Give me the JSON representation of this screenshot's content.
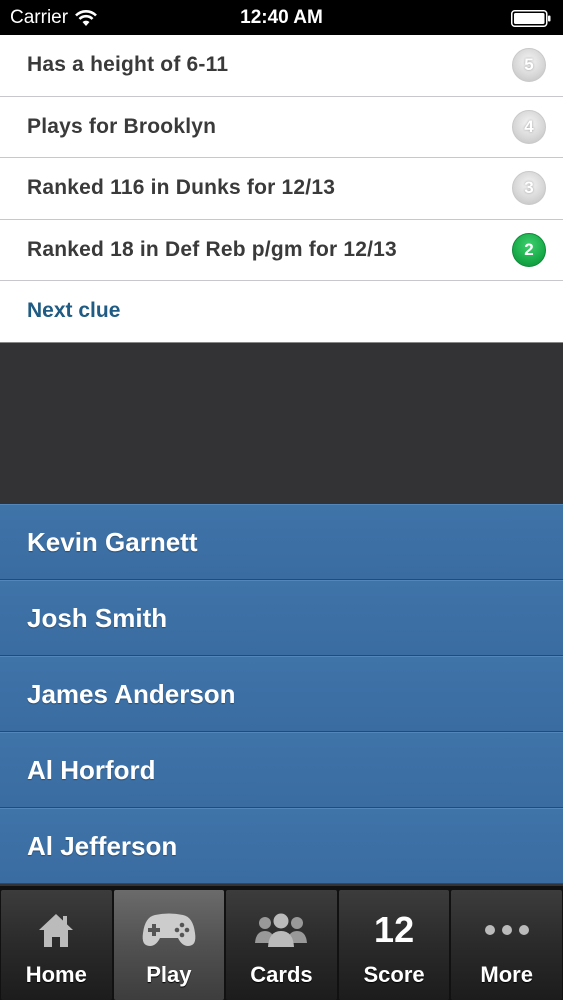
{
  "status": {
    "carrier": "Carrier",
    "time": "12:40 AM"
  },
  "clues": [
    {
      "text": "Has a height of 6-11",
      "badge": "5",
      "badge_style": "grey"
    },
    {
      "text": "Plays for Brooklyn",
      "badge": "4",
      "badge_style": "grey"
    },
    {
      "text": "Ranked 116 in Dunks for 12/13",
      "badge": "3",
      "badge_style": "grey"
    },
    {
      "text": "Ranked 18 in Def Reb p/gm for 12/13",
      "badge": "2",
      "badge_style": "green"
    }
  ],
  "next_clue_label": "Next clue",
  "answers": [
    "Kevin Garnett",
    "Josh Smith",
    "James Anderson",
    "Al Horford",
    "Al Jefferson"
  ],
  "tabs": [
    {
      "label": "Home",
      "icon": "house-icon"
    },
    {
      "label": "Play",
      "icon": "gamepad-icon",
      "active": true
    },
    {
      "label": "Cards",
      "icon": "people-icon"
    },
    {
      "label": "Score",
      "icon": "score-number",
      "value": "12"
    },
    {
      "label": "More",
      "icon": "ellipsis-icon"
    }
  ],
  "colors": {
    "answer_bg": "#3a6ca1",
    "next_clue": "#1f5b82",
    "badge_green": "#16a847"
  }
}
